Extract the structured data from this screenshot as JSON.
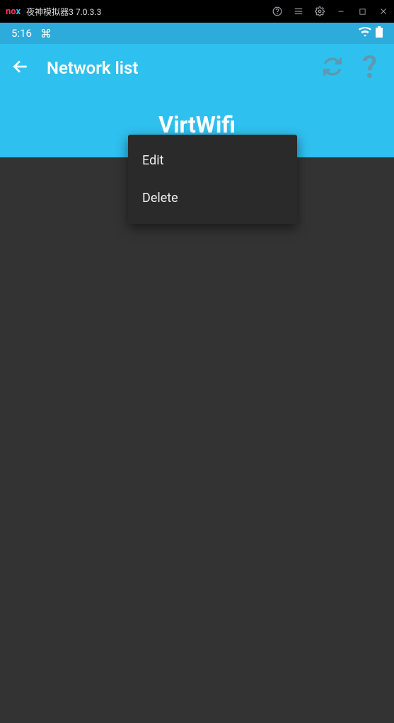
{
  "emulator": {
    "logo_left": "no",
    "logo_right": "x",
    "title": "夜神模拟器3 7.0.3.3"
  },
  "status": {
    "time": "5:16"
  },
  "header": {
    "title": "Network list"
  },
  "network": {
    "name": "VirtWifi"
  },
  "menu": {
    "edit": "Edit",
    "delete": "Delete"
  }
}
